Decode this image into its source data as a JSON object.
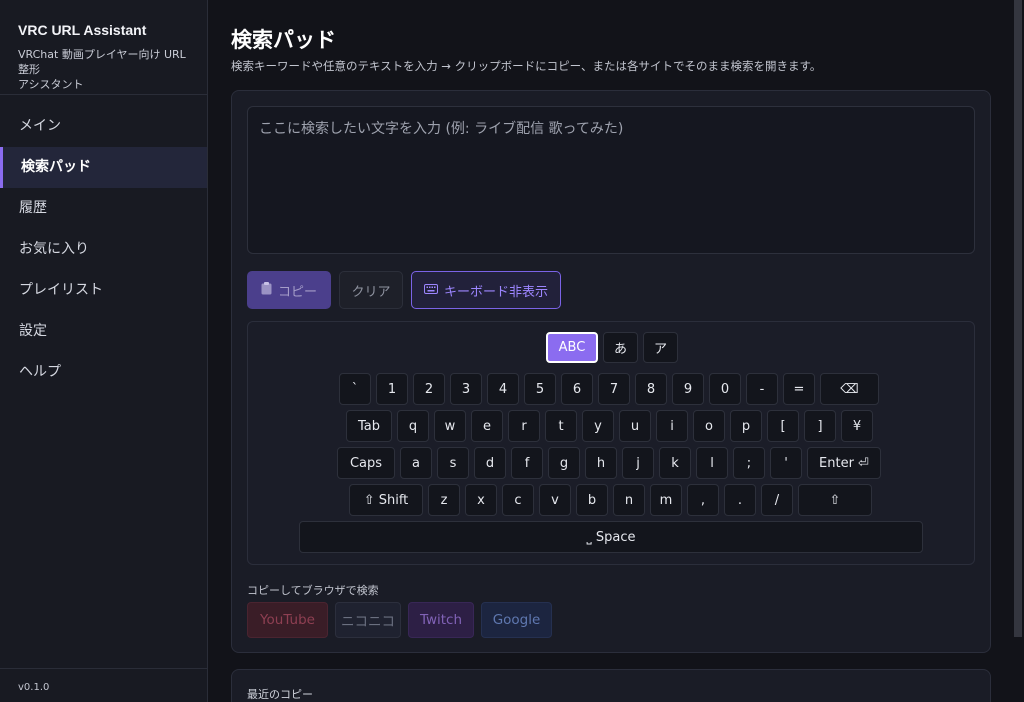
{
  "app": {
    "title": "VRC URL Assistant",
    "subtitle_line1": "VRChat 動画プレイヤー向け URL 整形",
    "subtitle_line2": "アシスタント",
    "version": "v0.1.0"
  },
  "sidebar": {
    "items": [
      {
        "label": "メイン",
        "active": false
      },
      {
        "label": "検索パッド",
        "active": true
      },
      {
        "label": "履歴",
        "active": false
      },
      {
        "label": "お気に入り",
        "active": false
      },
      {
        "label": "プレイリスト",
        "active": false
      },
      {
        "label": "設定",
        "active": false
      },
      {
        "label": "ヘルプ",
        "active": false
      }
    ]
  },
  "main": {
    "title": "検索パッド",
    "description": "検索キーワードや任意のテキストを入力 → クリップボードにコピー、または各サイトでそのまま検索を開きます。",
    "input": {
      "placeholder": "ここに検索したい文字を入力 (例: ライブ配信 歌ってみた)",
      "value": ""
    },
    "buttons": {
      "copy": "コピー",
      "copy_icon": "clipboard-icon",
      "clear": "クリア",
      "keyboard_toggle": "キーボード非表示",
      "keyboard_icon": "keyboard-icon"
    },
    "keyboard": {
      "modes": [
        "ABC",
        "あ",
        "ア"
      ],
      "active_mode": "ABC",
      "rows": [
        [
          "`",
          "1",
          "2",
          "3",
          "4",
          "5",
          "6",
          "7",
          "8",
          "9",
          "0",
          "-",
          "=",
          "⌫"
        ],
        [
          "Tab",
          "q",
          "w",
          "e",
          "r",
          "t",
          "y",
          "u",
          "i",
          "o",
          "p",
          "[",
          "]",
          "¥"
        ],
        [
          "Caps",
          "a",
          "s",
          "d",
          "f",
          "g",
          "h",
          "j",
          "k",
          "l",
          ";",
          "'",
          "Enter ⏎"
        ],
        [
          "⇧ Shift",
          "z",
          "x",
          "c",
          "v",
          "b",
          "n",
          "m",
          ",",
          ".",
          "/",
          "⇧"
        ],
        [
          "⎵ Space"
        ]
      ]
    },
    "search_section": {
      "label": "コピーしてブラウザで検索",
      "sites": [
        {
          "label": "YouTube",
          "bg": "#3a1d27",
          "color": "#8e3f52"
        },
        {
          "label": "ニコニコ",
          "bg": "#1f2230",
          "color": "#6b7080"
        },
        {
          "label": "Twitch",
          "bg": "#2d1f45",
          "color": "#8162b6"
        },
        {
          "label": "Google",
          "bg": "#1c2540",
          "color": "#5f78b0"
        }
      ]
    },
    "recent": {
      "label": "最近のコピー"
    }
  },
  "colors": {
    "accent": "#8b6cf0",
    "background": "#121319",
    "sidebar": "#181a22",
    "card": "#1a1c26"
  }
}
